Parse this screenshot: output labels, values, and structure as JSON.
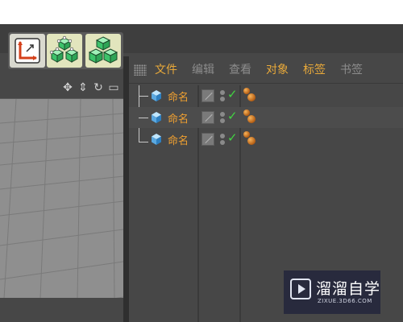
{
  "menu": {
    "items": [
      {
        "label": "文件",
        "state": "active"
      },
      {
        "label": "编辑",
        "state": "dim"
      },
      {
        "label": "查看",
        "state": "dim"
      },
      {
        "label": "对象",
        "state": "active"
      },
      {
        "label": "标签",
        "state": "active"
      },
      {
        "label": "书签",
        "state": "dim"
      }
    ]
  },
  "objects": [
    {
      "name": "命名",
      "visible_check": "✓"
    },
    {
      "name": "命名",
      "visible_check": "✓"
    },
    {
      "name": "命名",
      "visible_check": "✓"
    }
  ],
  "toolbar": {
    "buttons": [
      "axis-icon",
      "cube-cluster-icon",
      "cube-stack-icon"
    ]
  },
  "viewport": {
    "icons": [
      "move-icon",
      "vertical-move-icon",
      "rotate-icon",
      "maximize-icon"
    ]
  },
  "watermark": {
    "title": "溜溜自学",
    "subtitle": "ZIXUE.3D66.COM"
  },
  "colors": {
    "accent": "#e8a93a",
    "object_name": "#f0a030",
    "check": "#42d442",
    "panel_bg": "#474747"
  }
}
